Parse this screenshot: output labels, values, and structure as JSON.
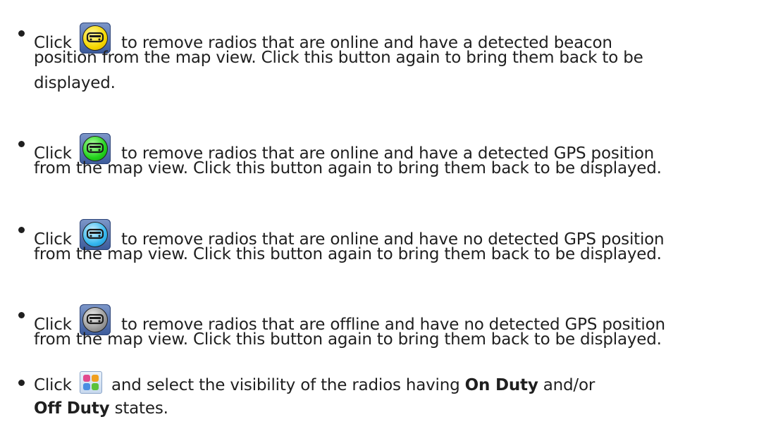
{
  "items": [
    {
      "click": "Click",
      "icon": "radio-beacon-icon",
      "icon_color": "#f5d800",
      "lines": [
        "to remove radios that are online and have a detected beacon",
        "position from the map view. Click this button again to bring them back to be",
        "displayed."
      ]
    },
    {
      "click": "Click",
      "icon": "radio-gps-icon",
      "icon_color": "#22d31c",
      "lines": [
        "to remove radios that are online and have a detected GPS position",
        "from the map view. Click this button again to bring them back to be displayed."
      ]
    },
    {
      "click": "Click",
      "icon": "radio-no-gps-icon",
      "icon_color": "#35b8ef",
      "lines": [
        "to remove radios that are online and have no detected GPS position",
        "from the map view. Click this button again to bring them back to be displayed."
      ]
    },
    {
      "click": "Click",
      "icon": "radio-offline-icon",
      "icon_color": "#9a9a9a",
      "lines": [
        "to remove radios that are offline and have no detected GPS position",
        "from the map view. Click this button again to bring them back to be displayed."
      ]
    },
    {
      "click": "Click",
      "icon": "duty-filter-icon",
      "line1_text": "and select the visibility of the radios having",
      "on_duty": "On Duty",
      "and_or": "and/or",
      "off_duty": "Off Duty",
      "states": "states."
    }
  ]
}
